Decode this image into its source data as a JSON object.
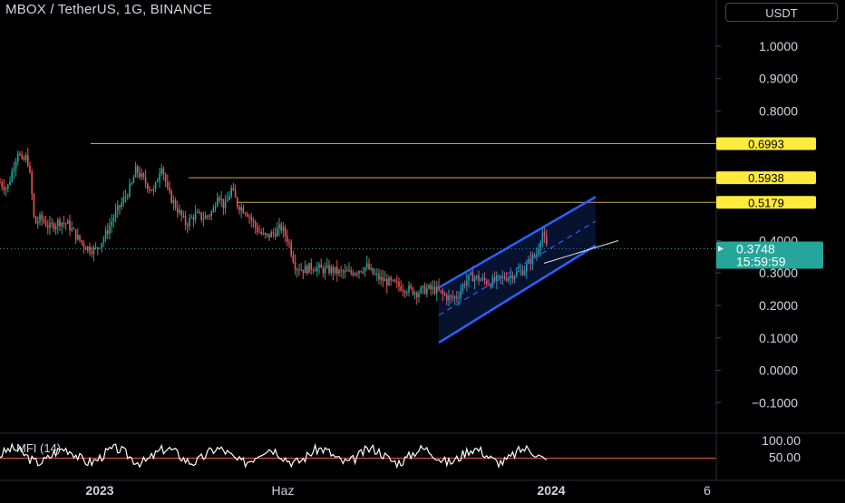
{
  "header": {
    "title": "MBOX / TetherUS, 1G, BINANCE",
    "currency_button": "USDT"
  },
  "colors": {
    "background": "#000000",
    "up": "#26a69a",
    "down": "#ef5350",
    "level_line": "#c8a951",
    "level_tag": "#ffeb3b",
    "channel": "#2962ff",
    "current_price_tag": "#26a69a",
    "mfi_line": "#ffffff",
    "mfi_level": "#ef5350"
  },
  "chart_data": {
    "type": "candlestick",
    "symbol": "MBOX / TetherUS",
    "interval": "1G",
    "exchange": "BINANCE",
    "y_axis_ticks": [
      "1.0000",
      "0.9000",
      "0.8000",
      "0.4000",
      "0.3000",
      "0.2000",
      "0.1000",
      "0.0000",
      "−0.1000"
    ],
    "ylim": [
      -0.13,
      1.12
    ],
    "x_axis_labels": [
      "2023",
      "Haz",
      "2024",
      "6"
    ],
    "horizontal_levels": [
      {
        "value": 0.6993,
        "label": "0.6993"
      },
      {
        "value": 0.5938,
        "label": "0.5938"
      },
      {
        "value": 0.5179,
        "label": "0.5179"
      }
    ],
    "current_price": {
      "value": 0.3748,
      "label": "0.3748",
      "countdown": "15:59:59"
    },
    "price_path": [
      [
        0,
        0.58
      ],
      [
        8,
        0.56
      ],
      [
        14,
        0.62
      ],
      [
        20,
        0.68
      ],
      [
        24,
        0.64
      ],
      [
        30,
        0.66
      ],
      [
        34,
        0.58
      ],
      [
        38,
        0.45
      ],
      [
        45,
        0.47
      ],
      [
        55,
        0.44
      ],
      [
        65,
        0.46
      ],
      [
        75,
        0.45
      ],
      [
        85,
        0.41
      ],
      [
        95,
        0.38
      ],
      [
        105,
        0.37
      ],
      [
        115,
        0.41
      ],
      [
        125,
        0.47
      ],
      [
        135,
        0.52
      ],
      [
        145,
        0.57
      ],
      [
        150,
        0.62
      ],
      [
        160,
        0.58
      ],
      [
        170,
        0.55
      ],
      [
        178,
        0.64
      ],
      [
        185,
        0.55
      ],
      [
        195,
        0.5
      ],
      [
        205,
        0.45
      ],
      [
        215,
        0.48
      ],
      [
        225,
        0.47
      ],
      [
        235,
        0.49
      ],
      [
        240,
        0.55
      ],
      [
        248,
        0.5
      ],
      [
        255,
        0.56
      ],
      [
        262,
        0.51
      ],
      [
        272,
        0.49
      ],
      [
        282,
        0.44
      ],
      [
        292,
        0.41
      ],
      [
        300,
        0.42
      ],
      [
        310,
        0.44
      ],
      [
        318,
        0.4
      ],
      [
        326,
        0.32
      ],
      [
        335,
        0.31
      ],
      [
        345,
        0.32
      ],
      [
        355,
        0.31
      ],
      [
        365,
        0.31
      ],
      [
        375,
        0.3
      ],
      [
        385,
        0.3
      ],
      [
        395,
        0.31
      ],
      [
        405,
        0.32
      ],
      [
        410,
        0.3
      ],
      [
        420,
        0.28
      ],
      [
        430,
        0.27
      ],
      [
        440,
        0.26
      ],
      [
        450,
        0.25
      ],
      [
        460,
        0.24
      ],
      [
        470,
        0.25
      ],
      [
        480,
        0.25
      ],
      [
        490,
        0.23
      ],
      [
        498,
        0.22
      ],
      [
        505,
        0.23
      ],
      [
        512,
        0.27
      ],
      [
        520,
        0.29
      ],
      [
        530,
        0.28
      ],
      [
        540,
        0.27
      ],
      [
        550,
        0.28
      ],
      [
        560,
        0.29
      ],
      [
        570,
        0.3
      ],
      [
        578,
        0.31
      ],
      [
        585,
        0.34
      ],
      [
        592,
        0.36
      ],
      [
        598,
        0.43
      ],
      [
        603,
        0.375
      ]
    ],
    "channel": {
      "upper": [
        [
          484,
          0.255
        ],
        [
          657,
          0.535
        ]
      ],
      "lower": [
        [
          484,
          0.085
        ],
        [
          657,
          0.385
        ]
      ],
      "median_dashed": [
        [
          484,
          0.17
        ],
        [
          657,
          0.46
        ]
      ],
      "extension": [
        [
          600,
          0.33
        ],
        [
          682,
          0.4
        ]
      ]
    },
    "indicator": {
      "name": "MFI",
      "label": "MFI (14)",
      "axis_ticks": [
        "100.00",
        "50.00"
      ],
      "ylim": [
        0,
        100
      ],
      "level": 50
    }
  }
}
